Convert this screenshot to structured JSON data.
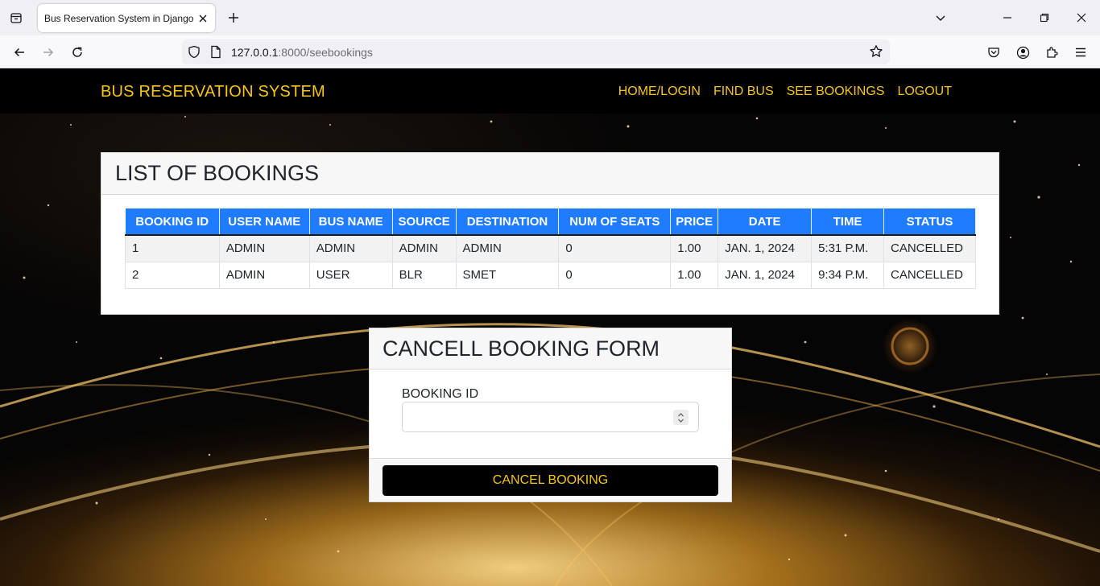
{
  "browser": {
    "tab_title": "Bus Reservation System in Django Fram",
    "url_host": "127.0.0.1",
    "url_rest": ":8000/seebookings"
  },
  "icons": {
    "tab_list": "tab-list-icon",
    "close_tab": "close-icon",
    "new_tab": "plus-icon",
    "back": "back-arrow-icon",
    "forward": "forward-arrow-icon",
    "reload": "reload-icon",
    "shield": "shield-icon",
    "page": "page-icon",
    "bookmark": "star-icon",
    "pocket": "pocket-icon",
    "account": "account-icon",
    "extensions": "puzzle-icon",
    "menu": "hamburger-menu-icon"
  },
  "site": {
    "brand": "BUS RESERVATION SYSTEM",
    "nav": [
      "HOME/LOGIN",
      "FIND BUS",
      "SEE BOOKINGS",
      "LOGOUT"
    ],
    "accent_color": "#f5c518",
    "header_color": "#000000"
  },
  "bookings": {
    "title": "LIST OF BOOKINGS",
    "header_color": "#1f7cff",
    "columns": [
      "BOOKING ID",
      "USER NAME",
      "BUS NAME",
      "SOURCE",
      "DESTINATION",
      "NUM OF SEATS",
      "PRICE",
      "DATE",
      "TIME",
      "STATUS"
    ],
    "rows": [
      [
        "1",
        "ADMIN",
        "ADMIN",
        "ADMIN",
        "ADMIN",
        "0",
        "1.00",
        "JAN. 1, 2024",
        "5:31 P.M.",
        "CANCELLED"
      ],
      [
        "2",
        "ADMIN",
        "USER",
        "BLR",
        "SMET",
        "0",
        "1.00",
        "JAN. 1, 2024",
        "9:34 P.M.",
        "CANCELLED"
      ]
    ]
  },
  "cancel_form": {
    "title": "CANCELL BOOKING FORM",
    "field_label": "BOOKING ID",
    "field_value": "",
    "button_label": "CANCEL BOOKING"
  }
}
